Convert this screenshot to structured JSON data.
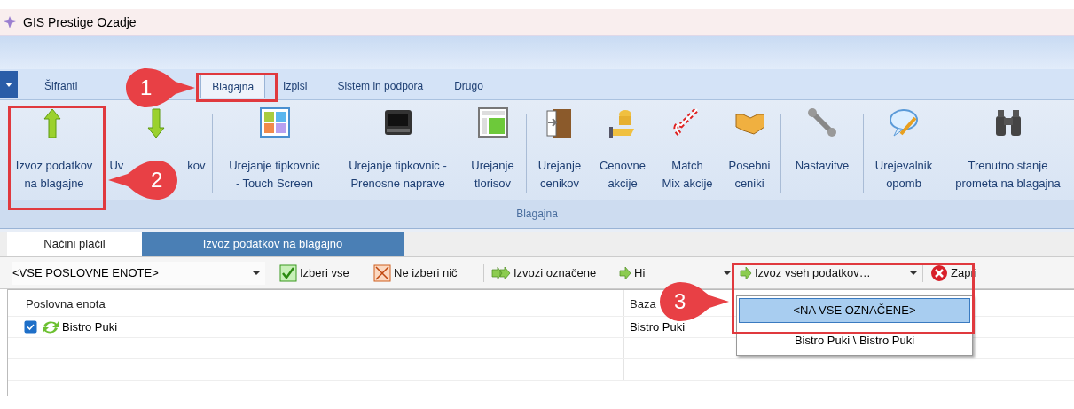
{
  "window": {
    "title": "GIS Prestige Ozadje"
  },
  "ribbon_tabs": [
    {
      "label": "Šifranti",
      "selected": false
    },
    {
      "label": "Blagajna",
      "selected": true
    },
    {
      "label": "Izpisi",
      "selected": false
    },
    {
      "label": "Sistem in podpora",
      "selected": false
    },
    {
      "label": "Drugo",
      "selected": false
    }
  ],
  "ribbon": {
    "group_label": "Blagajna",
    "buttons": [
      {
        "lines": [
          [
            "Izvoz podatkov"
          ],
          [
            "na blagajne"
          ]
        ]
      },
      {
        "lines": [
          [
            "Uv",
            "kov"
          ]
        ]
      },
      {
        "lines": [
          [
            "Urejanje tipkovnic"
          ],
          [
            "- Touch Screen"
          ]
        ]
      },
      {
        "lines": [
          [
            "Urejanje tipkovnic -"
          ],
          [
            "Prenosne naprave"
          ]
        ]
      },
      {
        "lines": [
          [
            "Urejanje"
          ],
          [
            "tlorisov"
          ]
        ]
      },
      {
        "lines": [
          [
            "Urejanje"
          ],
          [
            "cenikov"
          ]
        ]
      },
      {
        "lines": [
          [
            "Cenovne"
          ],
          [
            "akcije"
          ]
        ]
      },
      {
        "lines": [
          [
            "Match"
          ],
          [
            "Mix akcije"
          ]
        ]
      },
      {
        "lines": [
          [
            "Posebni"
          ],
          [
            "ceniki"
          ]
        ]
      },
      {
        "lines": [
          [
            "Nastavitve"
          ]
        ]
      },
      {
        "lines": [
          [
            "Urejevalnik"
          ],
          [
            "opomb"
          ]
        ]
      },
      {
        "lines": [
          [
            "Trenutno stanje"
          ],
          [
            "prometa na blagajna"
          ]
        ]
      }
    ]
  },
  "content_tabs": [
    {
      "label": "Načini plačil",
      "selected": false
    },
    {
      "label": "Izvoz podatkov na blagajno",
      "selected": true
    }
  ],
  "toolbar": {
    "unit_select": "<VSE POSLOVNE ENOTE>",
    "buttons": [
      {
        "label": "Izberi vse"
      },
      {
        "label": "Ne izberi nič"
      },
      {
        "label": "Izvozi označene"
      },
      {
        "label": "Hi"
      },
      {
        "label": "Izvoz vseh podatkov…"
      },
      {
        "label": "Zapri"
      }
    ]
  },
  "dropdown_menu": {
    "items": [
      {
        "label": "<NA VSE OZNAČENE>",
        "selected": true
      },
      {
        "label": "Bistro Puki \\ Bistro Puki",
        "selected": false
      }
    ]
  },
  "grid": {
    "columns": [
      "Poslovna enota",
      "Baza"
    ],
    "rows": [
      {
        "checked": true,
        "cells": [
          "Bistro Puki",
          "Bistro Puki"
        ]
      }
    ]
  },
  "callouts": [
    {
      "number": "1"
    },
    {
      "number": "2"
    },
    {
      "number": "3"
    }
  ]
}
